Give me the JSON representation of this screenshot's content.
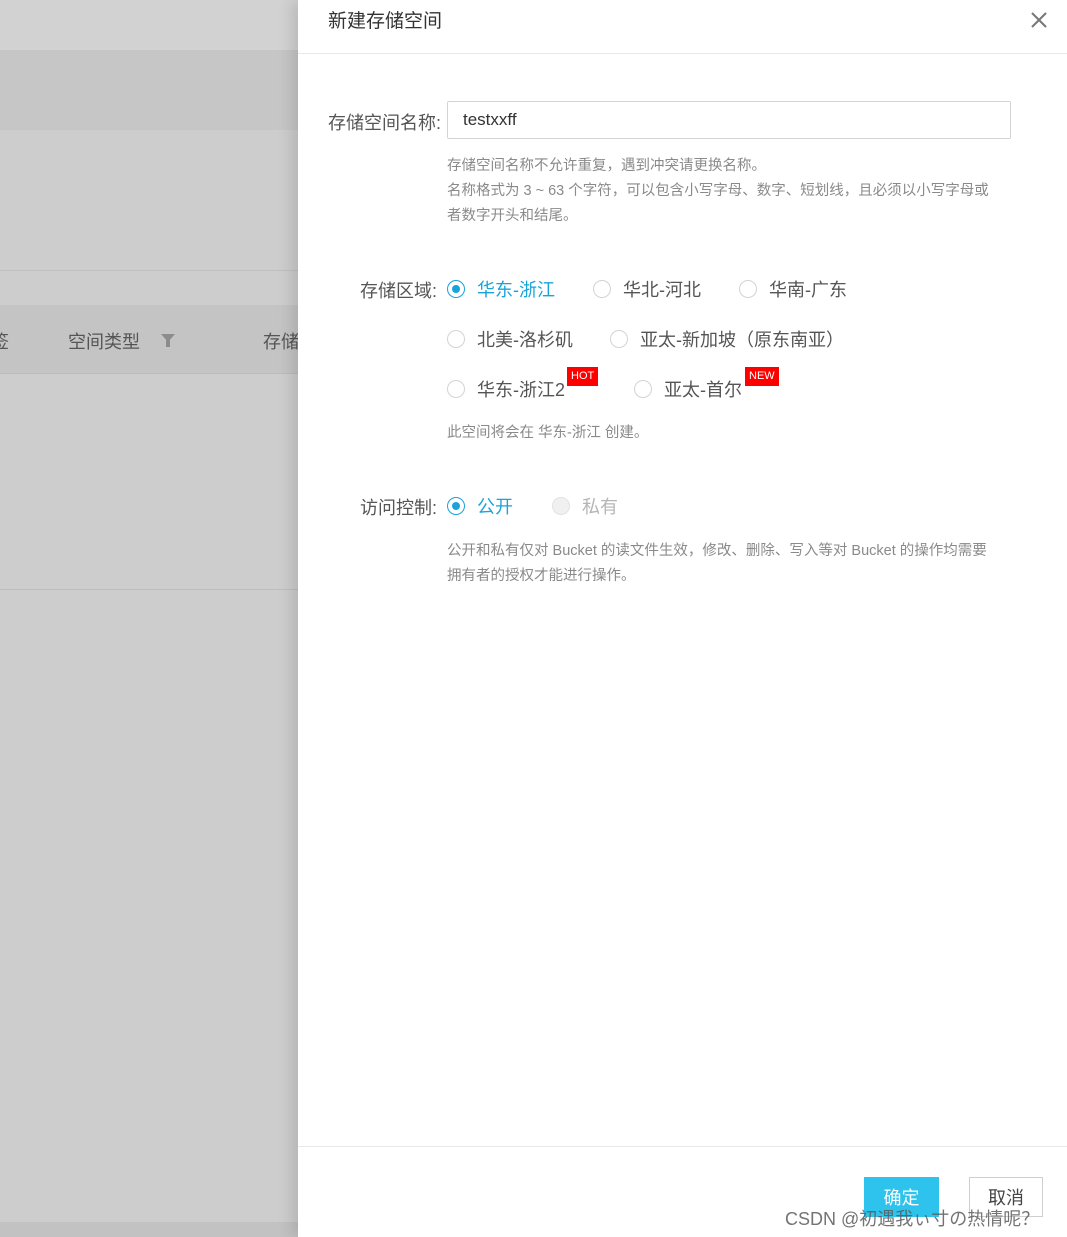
{
  "background": {
    "columns": [
      {
        "label": "签"
      },
      {
        "label": "空间类型"
      },
      {
        "label": "存储"
      }
    ]
  },
  "drawer": {
    "title": "新建存储空间",
    "name_field": {
      "label": "存储空间名称:",
      "value": "testxxff",
      "hints": [
        "存储空间名称不允许重复，遇到冲突请更换名称。",
        "名称格式为 3 ~ 63 个字符，可以包含小写字母、数字、短划线，且必须以小写字母或",
        "者数字开头和结尾。"
      ]
    },
    "region": {
      "label": "存储区域:",
      "options": [
        {
          "label": "华东-浙江",
          "checked": true
        },
        {
          "label": "华北-河北",
          "checked": false
        },
        {
          "label": "华南-广东",
          "checked": false
        },
        {
          "label": "北美-洛杉矶",
          "checked": false
        },
        {
          "label": "亚太-新加坡（原东南亚）",
          "checked": false
        },
        {
          "label": "华东-浙江2",
          "checked": false,
          "badge": "HOT"
        },
        {
          "label": "亚太-首尔",
          "checked": false,
          "badge": "NEW"
        }
      ],
      "note": "此空间将会在 华东-浙江 创建。"
    },
    "access": {
      "label": "访问控制:",
      "options": [
        {
          "label": "公开",
          "checked": true
        },
        {
          "label": "私有",
          "checked": false,
          "disabled": true
        }
      ],
      "hints": [
        "公开和私有仅对 Bucket 的读文件生效，修改、删除、写入等对 Bucket 的操作均需要",
        "拥有者的授权才能进行操作。"
      ]
    },
    "footer": {
      "confirm": "确定",
      "cancel": "取消"
    },
    "watermark": "CSDN @初遇我ぃ寸の热情呢？"
  },
  "colors": {
    "accent": "#1aa3d9",
    "primary_button": "#2dc3ec",
    "badge": "#ff0000"
  }
}
